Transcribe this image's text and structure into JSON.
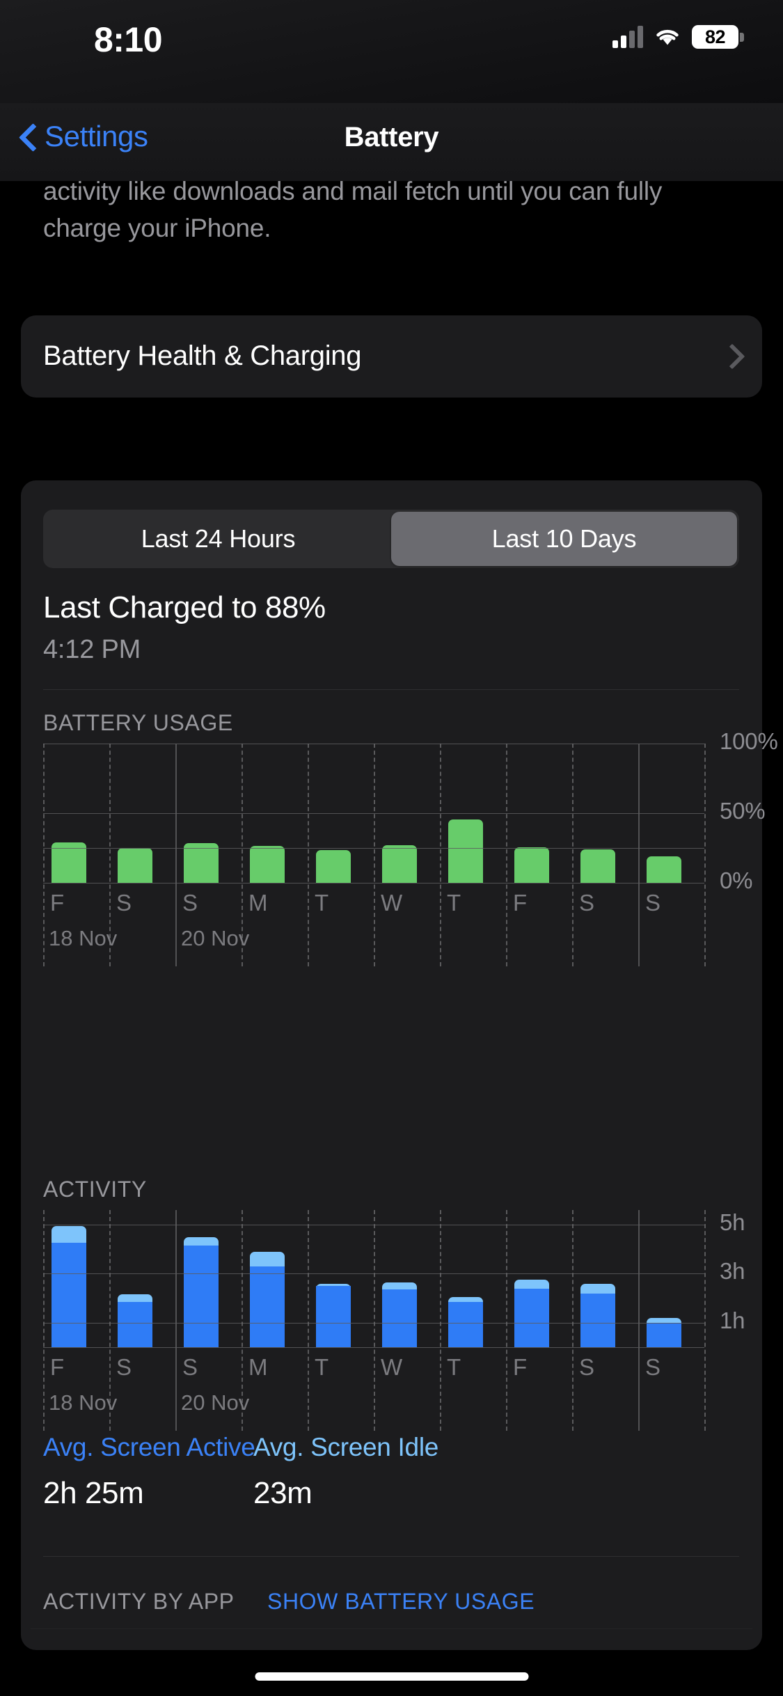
{
  "status_bar": {
    "time": "8:10",
    "battery_percent": "82",
    "cellular_icon": "cellular-signal-icon",
    "wifi_icon": "wifi-icon"
  },
  "nav": {
    "back_label": "Settings",
    "title": "Battery"
  },
  "intro": {
    "text": "activity like downloads and mail fetch until you can fully charge your iPhone."
  },
  "health_row": {
    "label": "Battery Health & Charging"
  },
  "segmented": {
    "options": [
      "Last 24 Hours",
      "Last 10 Days"
    ],
    "selected_index": 1
  },
  "charged": {
    "title": "Last Charged to 88%",
    "time": "4:12 PM"
  },
  "sections": {
    "battery_usage": "BATTERY USAGE",
    "activity": "ACTIVITY"
  },
  "stats": {
    "active_key": "Avg. Screen Active",
    "active_value": "2h 25m",
    "idle_key": "Avg. Screen Idle",
    "idle_value": "23m",
    "active_color": "#3b82f7",
    "idle_color": "#7ec4fb"
  },
  "footer": {
    "label": "ACTIVITY BY APP",
    "link": "SHOW BATTERY USAGE"
  },
  "chart_data": [
    {
      "type": "bar",
      "title": "BATTERY USAGE",
      "xlabel": "",
      "ylabel": "",
      "ylim": [
        0,
        100
      ],
      "yticks": [
        0,
        50,
        100
      ],
      "ytick_labels": [
        "0%",
        "50%",
        "100%"
      ],
      "gridlines": [
        0,
        25,
        50,
        100
      ],
      "grid": true,
      "bar_color": "#67cc6a",
      "categories": [
        "F",
        "S",
        "S",
        "M",
        "T",
        "W",
        "T",
        "F",
        "S",
        "S"
      ],
      "date_labels": [
        {
          "index": 0,
          "label": "18 Nov"
        },
        {
          "index": 2,
          "label": "20 Nov"
        }
      ],
      "values": [
        29,
        25,
        28.5,
        26.5,
        23.5,
        27,
        45.5,
        25.5,
        24,
        19
      ]
    },
    {
      "type": "bar",
      "title": "ACTIVITY",
      "xlabel": "",
      "ylabel": "",
      "ylim": [
        0,
        5.6
      ],
      "yticks": [
        1,
        3,
        5
      ],
      "ytick_labels": [
        "1h",
        "3h",
        "5h"
      ],
      "gridlines": [
        0,
        1,
        2,
        3,
        4,
        5
      ],
      "grid": true,
      "stacked": true,
      "categories": [
        "F",
        "S",
        "S",
        "M",
        "T",
        "W",
        "T",
        "F",
        "S",
        "S"
      ],
      "date_labels": [
        {
          "index": 0,
          "label": "18 Nov"
        },
        {
          "index": 2,
          "label": "20 Nov"
        }
      ],
      "series": [
        {
          "name": "Avg. Screen Active",
          "color": "#2f7cf6",
          "values": [
            4.25,
            1.85,
            4.15,
            3.3,
            2.5,
            2.35,
            1.85,
            2.4,
            2.2,
            1.0
          ]
        },
        {
          "name": "Avg. Screen Idle",
          "color": "#7ec4fb",
          "values": [
            0.7,
            0.3,
            0.35,
            0.6,
            0.1,
            0.3,
            0.2,
            0.35,
            0.4,
            0.2
          ]
        }
      ]
    }
  ]
}
